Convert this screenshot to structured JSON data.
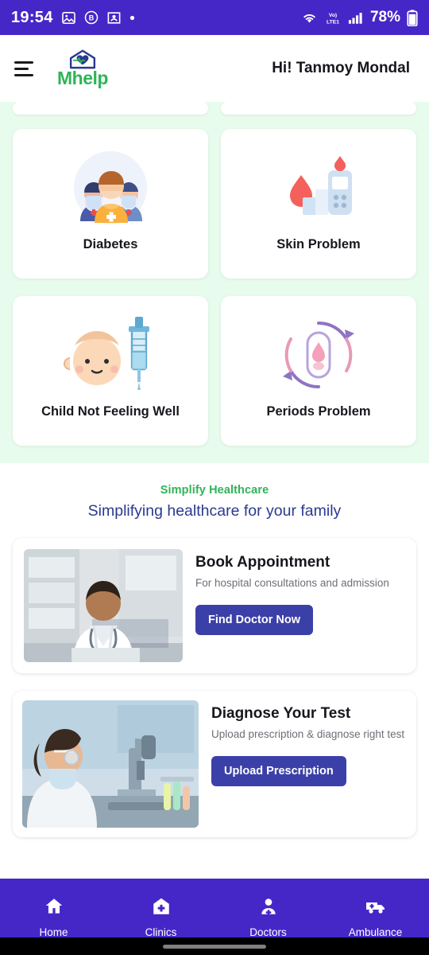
{
  "status_bar": {
    "time": "19:54",
    "battery": "78%",
    "icons": [
      "gallery-icon",
      "b-badge-icon",
      "contacts-icon",
      "dot-icon",
      "wifi-icon",
      "volte-icon",
      "signal-icon",
      "battery-icon"
    ]
  },
  "app_bar": {
    "menu_icon": "hamburger-menu-icon",
    "brand_name": "Mhelp",
    "greeting": "Hi! Tanmoy Mondal"
  },
  "symptom_cards": [
    {
      "label": "Diabetes",
      "art": "doctors-group-illustration"
    },
    {
      "label": "Skin Problem",
      "art": "blood-glucose-meter-illustration"
    },
    {
      "label": "Child Not Feeling Well",
      "art": "baby-syringe-illustration"
    },
    {
      "label": "Periods Problem",
      "art": "menstrual-cycle-illustration"
    }
  ],
  "simplify": {
    "kicker": "Simplify Healthcare",
    "title": "Simplifying healthcare for your family"
  },
  "promos": [
    {
      "image": "doctor-at-desk-photo",
      "title": "Book Appointment",
      "subtitle": "For hospital consultations and admission",
      "button": "Find Doctor Now"
    },
    {
      "image": "lab-technician-microscope-photo",
      "title": "Diagnose Your Test",
      "subtitle": "Upload prescription & diagnose right test",
      "button": "Upload Prescription"
    }
  ],
  "bottom_nav": [
    {
      "label": "Home",
      "icon": "home-icon"
    },
    {
      "label": "Clinics",
      "icon": "clinic-building-icon"
    },
    {
      "label": "Doctors",
      "icon": "doctor-person-icon"
    },
    {
      "label": "Ambulance",
      "icon": "ambulance-icon"
    }
  ],
  "colors": {
    "primary": "#4527c8",
    "accent_green": "#2fb457",
    "button_blue": "#3b40a8",
    "section_bg": "#e8fced",
    "title_navy": "#2b3990"
  }
}
